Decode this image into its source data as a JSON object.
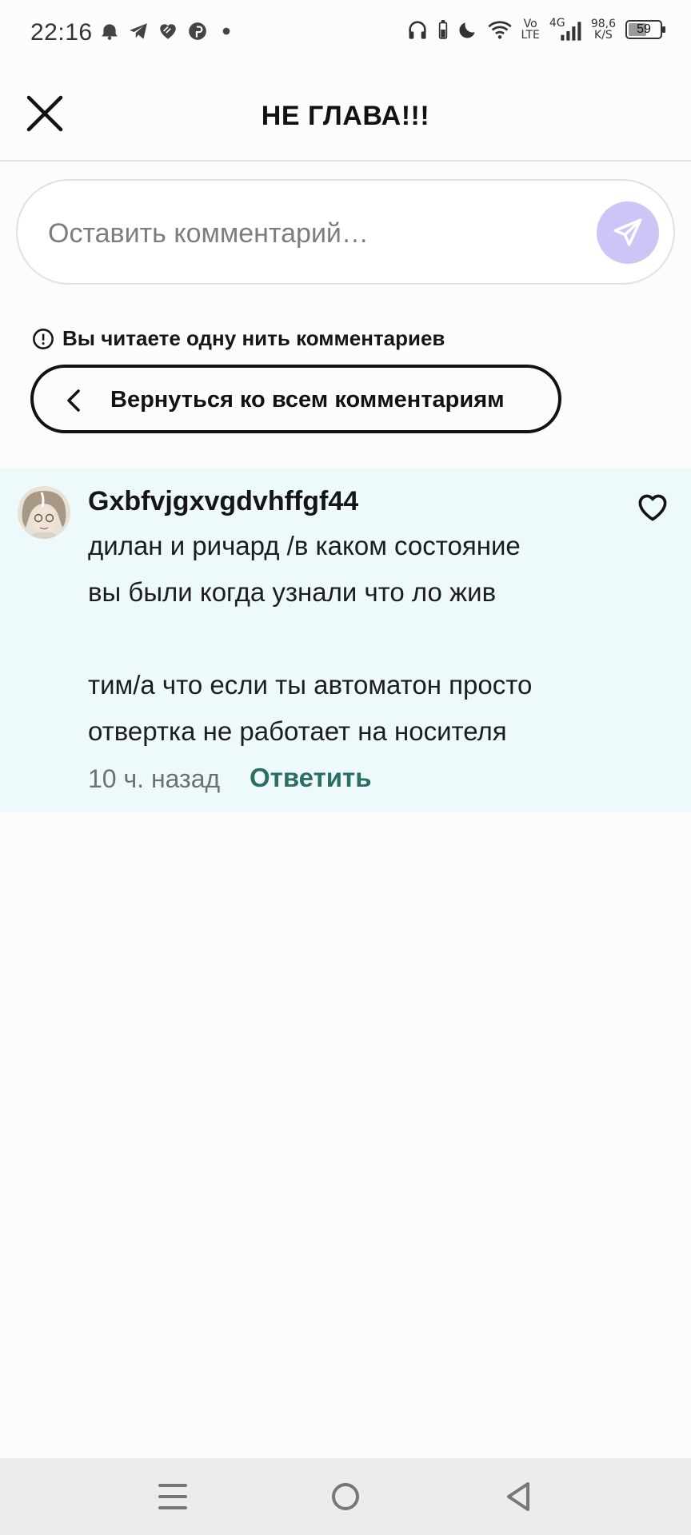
{
  "status_bar": {
    "time": "22:16",
    "network_top": "Vo",
    "network_bottom": "LTE",
    "signal_type": "4G",
    "speed_value": "98,6",
    "speed_unit": "K/S",
    "battery": "59",
    "battery_level": 0.59,
    "icons_left": [
      "alarm-icon",
      "telegram-icon",
      "heart-app-icon",
      "pinterest-icon",
      "dot-icon"
    ],
    "icons_right": [
      "headphones-icon",
      "battery-saver-icon",
      "moon-icon",
      "wifi-icon",
      "signal-icon"
    ]
  },
  "header": {
    "title": "НЕ ГЛАВА!!!",
    "close_icon": "close-icon"
  },
  "composer": {
    "placeholder": "Оставить комментарий…",
    "value": "",
    "send_icon": "send-icon",
    "send_color": "#ccc6f7"
  },
  "thread": {
    "notice": "Вы читаете одну нить комментариев",
    "back_label": "Вернуться ко всем комментариям"
  },
  "comment": {
    "author": "Gxbfvjgxvgdvhffgf44",
    "lines": [
      "дилан и ричард /в каком состояние",
      "вы были когда узнали что ло жив",
      "",
      "тим/а что если ты автоматон просто",
      "отвертка не работает на носителя"
    ],
    "time": "10 ч. назад",
    "reply_label": "Ответить",
    "background": "#eef9fc",
    "reply_color": "#2a6f62"
  },
  "nav": {
    "items": [
      "menu-icon",
      "home-icon",
      "back-icon"
    ]
  }
}
